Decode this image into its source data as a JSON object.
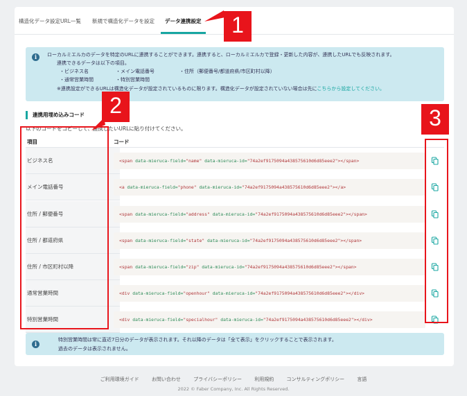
{
  "tabs": [
    {
      "label": "構造化データ設定URL一覧",
      "active": false
    },
    {
      "label": "新規で構造化データを設定",
      "active": false
    },
    {
      "label": "データ連携設定",
      "active": true
    }
  ],
  "info": {
    "line1": "ローカルミエルカのデータを特定のURLに連携することができます。連携すると、ローカルミエルカで登録・更新した内容が、連携したURLでも反映されます。",
    "line2": "連携できるデータは以下の項目。",
    "items": [
      "・ビジネス名",
      "・メイン電話番号",
      "・住所（郵便番号/都道府県/市区町村以降）",
      "・通常営業時間",
      "・特別営業時間"
    ],
    "line3": "※連携設定ができるURLは構造化データが設定されているものに限ります。構造化データが設定されていない場合は先に",
    "line3_link": "こちらから設定してください。"
  },
  "section": {
    "title": "連携用埋め込みコード",
    "description": "以下のコードをコピーして、連携したいURLに貼り付けてください。",
    "col_item": "項目",
    "col_code": "コード"
  },
  "rows": [
    {
      "label": "ビジネス名",
      "tag": "span",
      "field": "name"
    },
    {
      "label": "メイン電話番号",
      "tag": "a",
      "field": "phone"
    },
    {
      "label": "住所 / 郵便番号",
      "tag": "span",
      "field": "address"
    },
    {
      "label": "住所 / 都道府県",
      "tag": "span",
      "field": "state"
    },
    {
      "label": "住所 / 市区町村以降",
      "tag": "span",
      "field": "zip"
    },
    {
      "label": "通常営業時間",
      "tag": "div",
      "field": "openhour"
    },
    {
      "label": "特別営業時間",
      "tag": "div",
      "field": "specialhour"
    }
  ],
  "mieruca_id": "74a2ef9175094a438575610d6d85eee2",
  "note": {
    "line1": "特別営業時間は常に直近7日分のデータが表示されます。それ以降のデータは「全て表示」をクリックすることで表示されます。",
    "line2": "過去のデータは表示されません。"
  },
  "footer": {
    "links": [
      "ご利用環境ガイド",
      "お問い合わせ",
      "プライバシーポリシー",
      "利用規約",
      "コンサルティングポリシー",
      "言語"
    ],
    "copyright": "2022 © Faber Company, Inc. All Rights Reserved."
  },
  "annotations": [
    "1",
    "2",
    "3"
  ],
  "colors": {
    "accent": "#17a6a1",
    "annotation": "#e8141b",
    "info_bg": "#cce9f0"
  }
}
